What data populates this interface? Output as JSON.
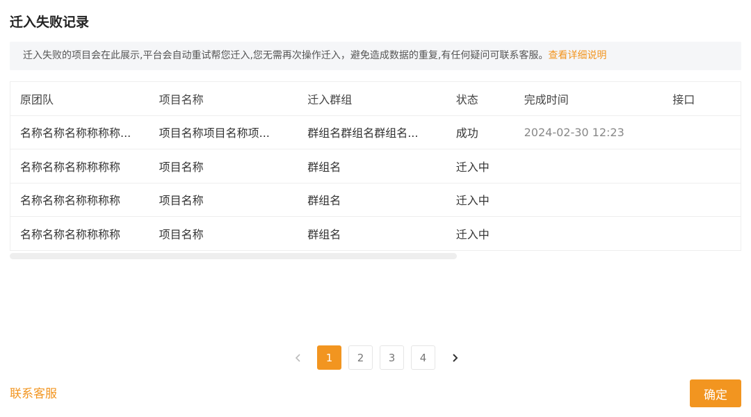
{
  "dialog": {
    "title": "迁入失败记录"
  },
  "notice": {
    "text": "迁入失败的项目会在此展示,平台会自动重试帮您迁入,您无需再次操作迁入，避免造成数据的重复,有任何疑问可联系客服。",
    "link": "查看详细说明"
  },
  "table": {
    "headers": [
      "原团队",
      "项目名称",
      "迁入群组",
      "状态",
      "完成时间",
      "接口"
    ],
    "rows": [
      [
        "名称名称名称称称称...",
        "项目名称项目名称项...",
        "群组名群组名群组名...",
        "成功",
        "2024-02-30 12:23",
        ""
      ],
      [
        "名称名称名称称称称",
        "项目名称",
        "群组名",
        "迁入中",
        "",
        ""
      ],
      [
        "名称名称名称称称称",
        "项目名称",
        "群组名",
        "迁入中",
        "",
        ""
      ],
      [
        "名称名称名称称称称",
        "项目名称",
        "群组名",
        "迁入中",
        "",
        ""
      ]
    ]
  },
  "pagination": {
    "prev_icon": "chevron-left-icon",
    "next_icon": "chevron-right-icon",
    "pages": [
      "1",
      "2",
      "3",
      "4"
    ],
    "current": "1"
  },
  "footer": {
    "contact": "联系客服",
    "confirm": "确定"
  },
  "colors": {
    "accent": "#f29520",
    "notice_bg": "#f5f6f8"
  }
}
